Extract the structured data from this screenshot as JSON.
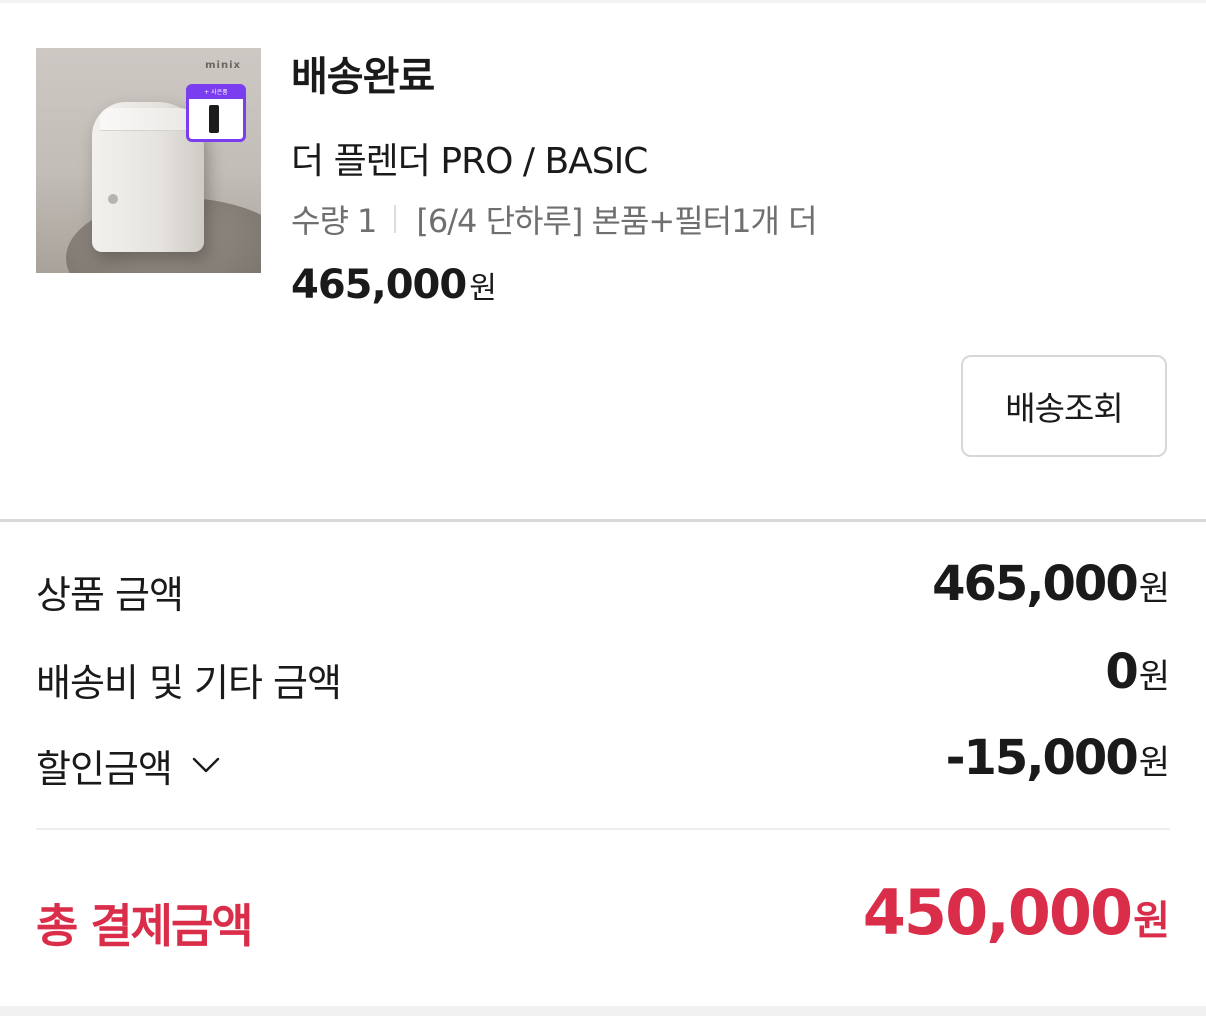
{
  "order_item": {
    "status": "배송완료",
    "product_name": "더 플렌더 PRO / BASIC",
    "quantity_text": "수량 1",
    "option_text": "[6/4 단하루] 본품+필터1개 더",
    "price": "465,000",
    "price_unit": "원",
    "image": {
      "logo_text": "minix",
      "gift_tag_text": "+ 사은품"
    },
    "track_button_label": "배송조회"
  },
  "summary": {
    "rows": [
      {
        "label": "상품 금액",
        "value": "465,000",
        "unit": "원"
      },
      {
        "label": "배송비 및 기타 금액",
        "value": "0",
        "unit": "원"
      },
      {
        "label": "할인금액",
        "value": "-15,000",
        "unit": "원",
        "icon": "chevron-down-icon"
      }
    ],
    "total": {
      "label": "총 결제금액",
      "value": "450,000",
      "unit": "원"
    }
  },
  "colors": {
    "accent": "#d92d4a",
    "text": "#1a1a1a",
    "muted": "#6f6f6f",
    "divider": "#d9d9d9",
    "gift_badge": "#7a3df0"
  }
}
